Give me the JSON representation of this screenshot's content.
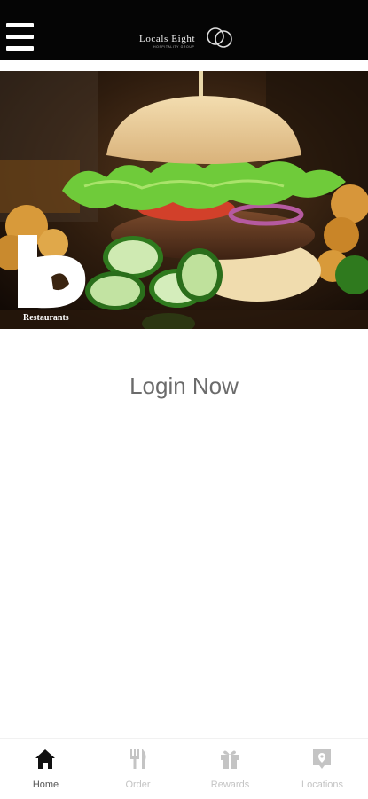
{
  "header": {
    "menu_icon": "hamburger-icon",
    "brand_name": "Locals Eight",
    "brand_tagline": "HOSPITALITY GROUP"
  },
  "hero": {
    "logo_letter": "b",
    "logo_caption": "Restaurants",
    "slide_count": 5,
    "active_slide": 1
  },
  "main": {
    "login_label": "Login Now"
  },
  "tabbar": {
    "items": [
      {
        "label": "Home",
        "icon": "home-icon",
        "active": true
      },
      {
        "label": "Order",
        "icon": "fork-knife-icon",
        "active": false
      },
      {
        "label": "Rewards",
        "icon": "gift-icon",
        "active": false
      },
      {
        "label": "Locations",
        "icon": "map-pin-icon",
        "active": false
      }
    ]
  },
  "colors": {
    "header_bg": "#050505",
    "active_tab": "#222222",
    "inactive_tab": "#c4c4c4",
    "login_text": "#6b6b6b"
  }
}
